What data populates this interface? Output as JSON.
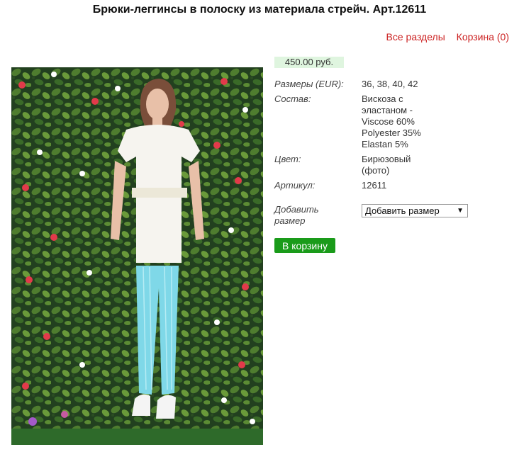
{
  "header": {
    "title": "Брюки-леггинсы в полоску из материала стрейч. Арт.12611"
  },
  "nav": {
    "all_sections": "Все разделы",
    "cart": "Корзина (0)"
  },
  "product": {
    "price": "450.00 руб.",
    "sizes_label": "Размеры (EUR):",
    "sizes_value": "36, 38, 40, 42",
    "composition_label": "Состав:",
    "composition_value_1": "Вискоза с",
    "composition_value_2": "эластаном -",
    "composition_value_3": "Viscose 60%",
    "composition_value_4": "Polyester 35%",
    "composition_value_5": "Elastan 5%",
    "color_label": "Цвет:",
    "color_value_1": "Бирюзовый",
    "color_value_2": "(фото)",
    "article_label": "Артикул:",
    "article_value": "12611",
    "add_size_label_1": "Добавить",
    "add_size_label_2": "размер",
    "size_select_value": "Добавить размер",
    "cart_button": "В корзину"
  },
  "colors": {
    "link": "#cc2222",
    "price_bg": "#dff5df",
    "button": "#1a9b1a",
    "leggings": "#7fd8e8"
  }
}
